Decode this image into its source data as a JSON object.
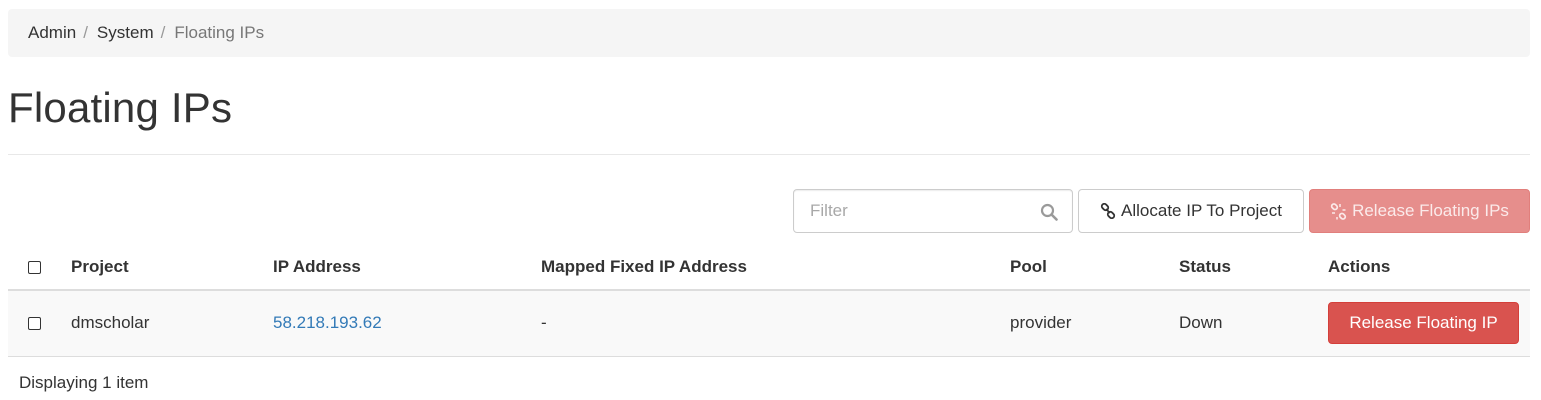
{
  "breadcrumb": {
    "items": [
      "Admin",
      "System",
      "Floating IPs"
    ],
    "separator": "/"
  },
  "page": {
    "title": "Floating IPs"
  },
  "toolbar": {
    "filter_placeholder": "Filter",
    "filter_value": "",
    "search_icon": "search-icon",
    "allocate_label": "Allocate IP To Project",
    "allocate_icon": "link-icon",
    "release_bulk_label": "Release Floating IPs",
    "release_bulk_icon": "unlink-icon",
    "release_bulk_disabled": true
  },
  "table": {
    "columns": [
      "Project",
      "IP Address",
      "Mapped Fixed IP Address",
      "Pool",
      "Status",
      "Actions"
    ],
    "rows": [
      {
        "project": "dmscholar",
        "ip_address": "58.218.193.62",
        "mapped_fixed_ip": "-",
        "pool": "provider",
        "status": "Down",
        "action_label": "Release Floating IP"
      }
    ],
    "footer": "Displaying 1 item"
  },
  "colors": {
    "link": "#337ab7",
    "danger": "#d9534f",
    "danger_disabled": "#e68e8c",
    "breadcrumb_bg": "#f5f5f5",
    "row_bg": "#f9f9f9"
  }
}
